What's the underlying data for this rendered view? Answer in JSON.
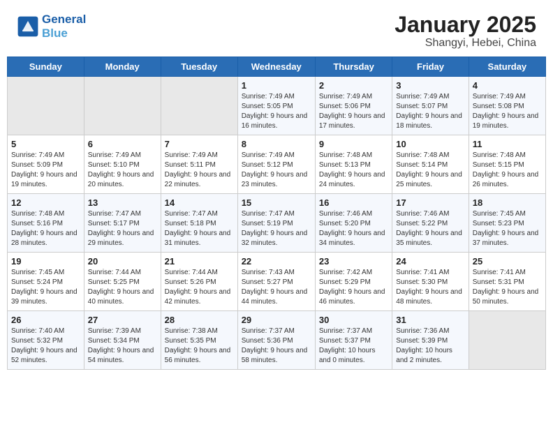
{
  "header": {
    "logo_line1": "General",
    "logo_line2": "Blue",
    "title": "January 2025",
    "subtitle": "Shangyi, Hebei, China"
  },
  "calendar": {
    "days_of_week": [
      "Sunday",
      "Monday",
      "Tuesday",
      "Wednesday",
      "Thursday",
      "Friday",
      "Saturday"
    ],
    "weeks": [
      [
        {
          "day": "",
          "sunrise": "",
          "sunset": "",
          "daylight": ""
        },
        {
          "day": "",
          "sunrise": "",
          "sunset": "",
          "daylight": ""
        },
        {
          "day": "",
          "sunrise": "",
          "sunset": "",
          "daylight": ""
        },
        {
          "day": "1",
          "sunrise": "Sunrise: 7:49 AM",
          "sunset": "Sunset: 5:05 PM",
          "daylight": "Daylight: 9 hours and 16 minutes."
        },
        {
          "day": "2",
          "sunrise": "Sunrise: 7:49 AM",
          "sunset": "Sunset: 5:06 PM",
          "daylight": "Daylight: 9 hours and 17 minutes."
        },
        {
          "day": "3",
          "sunrise": "Sunrise: 7:49 AM",
          "sunset": "Sunset: 5:07 PM",
          "daylight": "Daylight: 9 hours and 18 minutes."
        },
        {
          "day": "4",
          "sunrise": "Sunrise: 7:49 AM",
          "sunset": "Sunset: 5:08 PM",
          "daylight": "Daylight: 9 hours and 19 minutes."
        }
      ],
      [
        {
          "day": "5",
          "sunrise": "Sunrise: 7:49 AM",
          "sunset": "Sunset: 5:09 PM",
          "daylight": "Daylight: 9 hours and 19 minutes."
        },
        {
          "day": "6",
          "sunrise": "Sunrise: 7:49 AM",
          "sunset": "Sunset: 5:10 PM",
          "daylight": "Daylight: 9 hours and 20 minutes."
        },
        {
          "day": "7",
          "sunrise": "Sunrise: 7:49 AM",
          "sunset": "Sunset: 5:11 PM",
          "daylight": "Daylight: 9 hours and 22 minutes."
        },
        {
          "day": "8",
          "sunrise": "Sunrise: 7:49 AM",
          "sunset": "Sunset: 5:12 PM",
          "daylight": "Daylight: 9 hours and 23 minutes."
        },
        {
          "day": "9",
          "sunrise": "Sunrise: 7:48 AM",
          "sunset": "Sunset: 5:13 PM",
          "daylight": "Daylight: 9 hours and 24 minutes."
        },
        {
          "day": "10",
          "sunrise": "Sunrise: 7:48 AM",
          "sunset": "Sunset: 5:14 PM",
          "daylight": "Daylight: 9 hours and 25 minutes."
        },
        {
          "day": "11",
          "sunrise": "Sunrise: 7:48 AM",
          "sunset": "Sunset: 5:15 PM",
          "daylight": "Daylight: 9 hours and 26 minutes."
        }
      ],
      [
        {
          "day": "12",
          "sunrise": "Sunrise: 7:48 AM",
          "sunset": "Sunset: 5:16 PM",
          "daylight": "Daylight: 9 hours and 28 minutes."
        },
        {
          "day": "13",
          "sunrise": "Sunrise: 7:47 AM",
          "sunset": "Sunset: 5:17 PM",
          "daylight": "Daylight: 9 hours and 29 minutes."
        },
        {
          "day": "14",
          "sunrise": "Sunrise: 7:47 AM",
          "sunset": "Sunset: 5:18 PM",
          "daylight": "Daylight: 9 hours and 31 minutes."
        },
        {
          "day": "15",
          "sunrise": "Sunrise: 7:47 AM",
          "sunset": "Sunset: 5:19 PM",
          "daylight": "Daylight: 9 hours and 32 minutes."
        },
        {
          "day": "16",
          "sunrise": "Sunrise: 7:46 AM",
          "sunset": "Sunset: 5:20 PM",
          "daylight": "Daylight: 9 hours and 34 minutes."
        },
        {
          "day": "17",
          "sunrise": "Sunrise: 7:46 AM",
          "sunset": "Sunset: 5:22 PM",
          "daylight": "Daylight: 9 hours and 35 minutes."
        },
        {
          "day": "18",
          "sunrise": "Sunrise: 7:45 AM",
          "sunset": "Sunset: 5:23 PM",
          "daylight": "Daylight: 9 hours and 37 minutes."
        }
      ],
      [
        {
          "day": "19",
          "sunrise": "Sunrise: 7:45 AM",
          "sunset": "Sunset: 5:24 PM",
          "daylight": "Daylight: 9 hours and 39 minutes."
        },
        {
          "day": "20",
          "sunrise": "Sunrise: 7:44 AM",
          "sunset": "Sunset: 5:25 PM",
          "daylight": "Daylight: 9 hours and 40 minutes."
        },
        {
          "day": "21",
          "sunrise": "Sunrise: 7:44 AM",
          "sunset": "Sunset: 5:26 PM",
          "daylight": "Daylight: 9 hours and 42 minutes."
        },
        {
          "day": "22",
          "sunrise": "Sunrise: 7:43 AM",
          "sunset": "Sunset: 5:27 PM",
          "daylight": "Daylight: 9 hours and 44 minutes."
        },
        {
          "day": "23",
          "sunrise": "Sunrise: 7:42 AM",
          "sunset": "Sunset: 5:29 PM",
          "daylight": "Daylight: 9 hours and 46 minutes."
        },
        {
          "day": "24",
          "sunrise": "Sunrise: 7:41 AM",
          "sunset": "Sunset: 5:30 PM",
          "daylight": "Daylight: 9 hours and 48 minutes."
        },
        {
          "day": "25",
          "sunrise": "Sunrise: 7:41 AM",
          "sunset": "Sunset: 5:31 PM",
          "daylight": "Daylight: 9 hours and 50 minutes."
        }
      ],
      [
        {
          "day": "26",
          "sunrise": "Sunrise: 7:40 AM",
          "sunset": "Sunset: 5:32 PM",
          "daylight": "Daylight: 9 hours and 52 minutes."
        },
        {
          "day": "27",
          "sunrise": "Sunrise: 7:39 AM",
          "sunset": "Sunset: 5:34 PM",
          "daylight": "Daylight: 9 hours and 54 minutes."
        },
        {
          "day": "28",
          "sunrise": "Sunrise: 7:38 AM",
          "sunset": "Sunset: 5:35 PM",
          "daylight": "Daylight: 9 hours and 56 minutes."
        },
        {
          "day": "29",
          "sunrise": "Sunrise: 7:37 AM",
          "sunset": "Sunset: 5:36 PM",
          "daylight": "Daylight: 9 hours and 58 minutes."
        },
        {
          "day": "30",
          "sunrise": "Sunrise: 7:37 AM",
          "sunset": "Sunset: 5:37 PM",
          "daylight": "Daylight: 10 hours and 0 minutes."
        },
        {
          "day": "31",
          "sunrise": "Sunrise: 7:36 AM",
          "sunset": "Sunset: 5:39 PM",
          "daylight": "Daylight: 10 hours and 2 minutes."
        },
        {
          "day": "",
          "sunrise": "",
          "sunset": "",
          "daylight": ""
        }
      ]
    ]
  }
}
